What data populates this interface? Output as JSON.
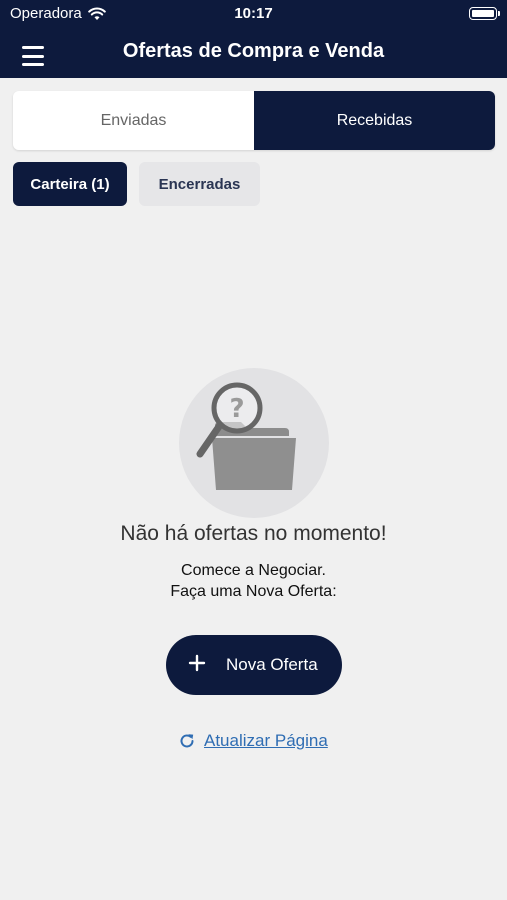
{
  "status_bar": {
    "carrier": "Operadora",
    "time": "10:17"
  },
  "header": {
    "title": "Ofertas de Compra e Venda",
    "menu_icon": "hamburger-menu-icon"
  },
  "tabs": [
    {
      "label": "Enviadas",
      "active": false
    },
    {
      "label": "Recebidas",
      "active": true
    }
  ],
  "filters": [
    {
      "label": "Carteira (1)",
      "active": true
    },
    {
      "label": "Encerradas",
      "active": false
    }
  ],
  "empty_state": {
    "icon": "folder-search-icon",
    "title": "Não há ofertas no momento!",
    "line1": "Comece a Negociar.",
    "line2": "Faça uma Nova Oferta:"
  },
  "new_offer_button": {
    "label": "Nova Oferta",
    "icon": "plus-icon"
  },
  "refresh_link": {
    "label": "Atualizar Página",
    "icon": "refresh-icon"
  },
  "colors": {
    "navy": "#0d1a3d",
    "background": "#f0f0f0",
    "link": "#2f6db3"
  }
}
